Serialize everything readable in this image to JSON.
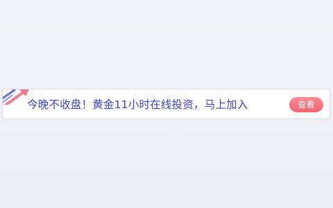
{
  "promo_banner": {
    "headline": "今晚不收盘！黄金11小时在线投资，马上加入",
    "cta_label": "查看",
    "colors": {
      "text": "#3b46c8",
      "button": "#f2646f",
      "arrow_pink": "#f27a8a",
      "arrow_purple": "#6a6fd8"
    },
    "decoration_icon": "upward-arrow-icon"
  }
}
